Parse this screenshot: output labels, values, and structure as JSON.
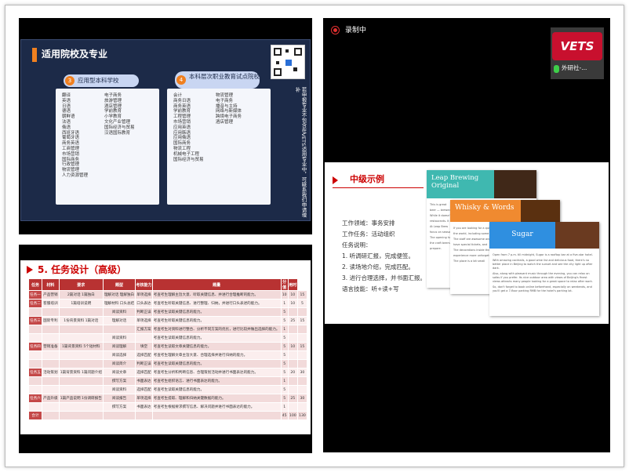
{
  "panel1": {
    "title": "适用院校及专业",
    "group1": {
      "number": "3",
      "title": "应用型本科学校",
      "col1": [
        "翻译",
        "英语",
        "日语",
        "德语",
        "朝鲜语",
        "法语",
        "俄语",
        "西班牙语",
        "葡萄牙语",
        "商务英语",
        "工商管理",
        "市场营销",
        "国际商务",
        "行政管理",
        "物流管理",
        "人力资源管理"
      ],
      "col2": [
        "电子商务",
        "旅游管理",
        "酒店管理",
        "学前教育",
        "小学教育",
        "文化产业管理",
        "国际经济与贸易",
        "汉语国际教育"
      ]
    },
    "group2": {
      "number": "4",
      "title": "本科层次职业教育试点院校",
      "col1": [
        "会计",
        "商务日语",
        "商务英语",
        "学前教育",
        "工程管理",
        "市场营销",
        "应用英语",
        "应用韩语",
        "应用俄语",
        "国际商务",
        "物流工程",
        "机械电子工程",
        "国际经济与贸易"
      ],
      "col2": [
        "物流管理",
        "电子商务",
        "播音与主持",
        "网络与新媒体",
        "跨境电子商务",
        "酒店管理"
      ]
    },
    "vertical_note": "若申报专业不包含在VETS适用专业中，可联系我们申请增补"
  },
  "panel2": {
    "recording_label": "录制中",
    "avatar_logo": "VETS",
    "participant_name": "外研社-...",
    "slide": {
      "title": "中级示例",
      "lines": [
        "工作领域：事务安排",
        "工作任务：活动组织",
        "任务说明：",
        "1. 听调研汇报，完成便签。",
        "2. 读场地介绍，完成匹配。",
        "3. 进行合理选择，并书面汇报。",
        "语言技能：听+读+写"
      ],
      "cards": [
        {
          "name": "Leap Brewing Original",
          "body": [
            "This is great",
            "beer — brewed",
            "While it doesn't",
            "restaurants. It",
            "At Leap Brew",
            "focus on seasonal",
            "The opening hours",
            "the craft beers",
            "prepare."
          ]
        },
        {
          "name": "Whisky & Words",
          "body": [
            "If you are looking for a quiet",
            "the world, including some",
            "The staff are awesome and",
            "have special tickets, and",
            "The decorations inside the",
            "experience more unforgettable",
            "The place is a bit small"
          ]
        },
        {
          "name": "Sugar",
          "body": [
            "Open from 7 p.m. till midnight, Sugar is a rooftop bar at a five-star hotel.",
            "With amazing cocktails, a good wine list and delicious food, there's no better place in Beijing to watch the sunset and see the city light up after dark.",
            "Also, along with pleasant music through the evening, you can relax on sofas if you prefer. Its nice outdoor area with views of Beijing's finest views attracts many people looking for a great space to relax after work.",
            "So, don't forget to book online beforehand, especially on weekends, and you'll get a 7-floor parking RMB for the hotel's parking lot."
          ]
        }
      ]
    }
  },
  "panel3": {
    "title": "5. 任务设计（高级）",
    "headers": [
      "任务",
      "材料",
      "要求",
      "题型",
      "考核能力",
      "题量",
      "分值",
      "用时"
    ],
    "rows": [
      [
        "任务一",
        "产品营销",
        "2篇对话\n1篇独白",
        "理解对话\n理解独白",
        "单项选择",
        "考查考生理解主旨大意、听取关键信息、并进行合理推断的能力。",
        "10",
        "10",
        "15"
      ],
      [
        "任务二",
        "客服培训",
        "1篇培训说明",
        "理解材料\n口头总结",
        "口头表达",
        "考查考生听取关键信息、进行整理、归纳，并进行口头表述的能力。",
        "1",
        "10",
        "5"
      ],
      [
        "",
        "",
        "",
        "阅读资料",
        "判断正误",
        "考查考生读取关键信息的能力。",
        "5",
        "",
        ""
      ],
      [
        "任务三",
        "国际专利",
        "1份背景资料\n1篇对话",
        "理解对话",
        "单项选择",
        "考查考生听取关键信息的能力。",
        "5",
        "25",
        "15"
      ],
      [
        "",
        "",
        "",
        "",
        "汇报方案",
        "考查考生对资料进行整合、分析不同方案的优劣，进行比较并做出选择的能力。",
        "1",
        "",
        ""
      ],
      [
        "",
        "",
        "",
        "阅读资料",
        "",
        "考查考生读取关键信息的能力。",
        "5",
        "",
        ""
      ],
      [
        "任务四",
        "营销准备",
        "1篇背景资料\n5个短材料",
        "阅读理解",
        "填空",
        "考查考生读取文章关键信息的能力。",
        "5",
        "10",
        "15"
      ],
      [
        "",
        "",
        "",
        "阅读选择",
        "选择匹配",
        "考查考生理解文章主旨大意、合理选择并进行归纳的能力。",
        "5",
        "",
        ""
      ],
      [
        "",
        "",
        "",
        "阅读简介",
        "判断正误",
        "考查考生读取关键信息的能力。",
        "5",
        "",
        ""
      ],
      [
        "任务五",
        "活动策划",
        "1篇背景资料\n1篇问题介绍",
        "阅读文章",
        "选择匹配",
        "考查考生分析和判断信息、合理策划活动并进行书面表达的能力。",
        "5",
        "20",
        "30"
      ],
      [
        "",
        "",
        "",
        "撰写方案",
        "书面表达",
        "考查考生组织语言、进行书面表达的能力。",
        "1",
        "",
        ""
      ],
      [
        "",
        "",
        "",
        "阅读资料",
        "选择匹配",
        "考查考生读取关键信息的能力。",
        "5",
        "",
        ""
      ],
      [
        "任务六",
        "产品升级",
        "1篇产品说明\n1份调研报告",
        "阅读报告",
        "单项选择",
        "考查考生提取、理解和归纳关键数据的能力。",
        "5",
        "25",
        "30"
      ],
      [
        "",
        "",
        "",
        "撰写方案",
        "书面表达",
        "考查考生根据要求撰写信息、解决问题并进行书面表达的能力。",
        "1",
        "",
        ""
      ]
    ],
    "total": [
      "合计",
      "",
      "",
      "",
      "",
      "",
      "45",
      "100",
      "130"
    ]
  }
}
